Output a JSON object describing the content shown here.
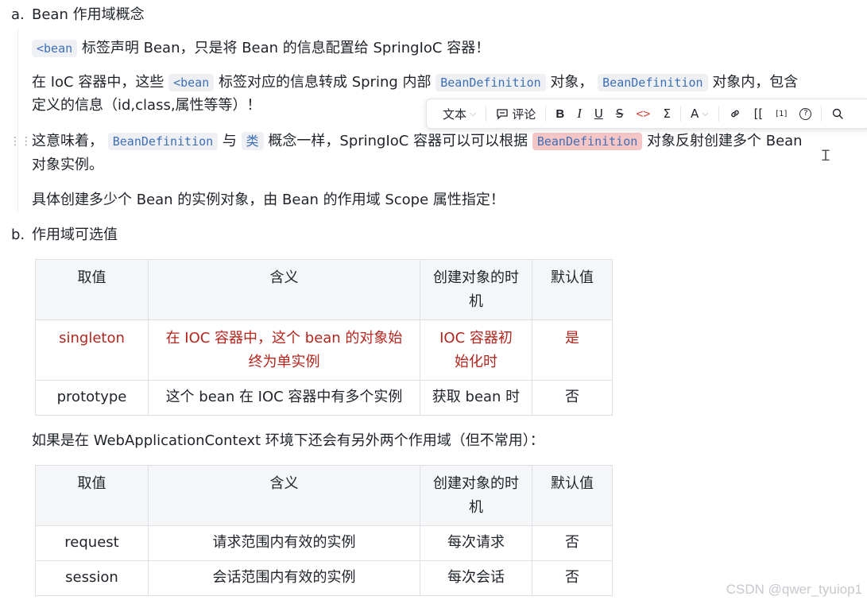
{
  "section_a": {
    "marker": "a.",
    "heading": "Bean 作用域概念",
    "p1": {
      "code": "<bean",
      "text": "标签声明 Bean，只是将 Bean 的信息配置给 SpringIoC 容器！"
    },
    "p2": {
      "t1": "在 IoC 容器中，这些",
      "code1": "<bean",
      "t2": "标签对应的信息转成 Spring 内部",
      "code2": "BeanDefinition",
      "t3": "对象，",
      "code3": "BeanDefinition",
      "t4": "对象内，包含",
      "t5": "定义的信息（id,class,属性等等）！"
    },
    "p3": {
      "t1": "这意味着，",
      "code1": "BeanDefinition",
      "t2": "与",
      "code2": "类",
      "t3": "概念一样，SpringIoC 容器可以可以根据",
      "code3": "BeanDefinition",
      "t4": "对象反射创建多个 Bean",
      "t5": "对象实例。"
    },
    "p4": "具体创建多少个 Bean 的实例对象，由 Bean 的作用域 Scope 属性指定！"
  },
  "section_b": {
    "marker": "b.",
    "heading": "作用域可选值",
    "table1": {
      "headers": [
        "取值",
        "含义",
        "创建对象的时\n机",
        "默认值"
      ],
      "rows": [
        [
          "singleton",
          "在 IOC 容器中，这个 bean 的对象始\n终为单实例",
          "IOC 容器初\n始化时",
          "是"
        ],
        [
          "prototype",
          "这个 bean 在 IOC 容器中有多个实例",
          "获取 bean 时",
          "否"
        ]
      ]
    },
    "note": "如果是在 WebApplicationContext 环境下还会有另外两个作用域（但不常用）：",
    "table2": {
      "headers": [
        "取值",
        "含义",
        "创建对象的时\n机",
        "默认值"
      ],
      "rows": [
        [
          "request",
          "请求范围内有效的实例",
          "每次请求",
          "否"
        ],
        [
          "session",
          "会话范围内有效的实例",
          "每次会话",
          "否"
        ]
      ]
    }
  },
  "toolbar": {
    "text_label": "文本",
    "comment_label": "评论",
    "bold": "B",
    "italic": "I",
    "underline": "U",
    "strike": "S",
    "code": "<>",
    "formula": "Σ",
    "color": "A",
    "wiki": "[[",
    "footnote": "[1]",
    "help": "?",
    "icons": [
      "comment-icon",
      "link-icon",
      "search-icon"
    ]
  },
  "watermark": "CSDN @qwer_tyuiop1",
  "colors": {
    "accent_red": "#b3261e",
    "code_blue": "#3d6fb6",
    "highlight": "#f6c6c6"
  }
}
